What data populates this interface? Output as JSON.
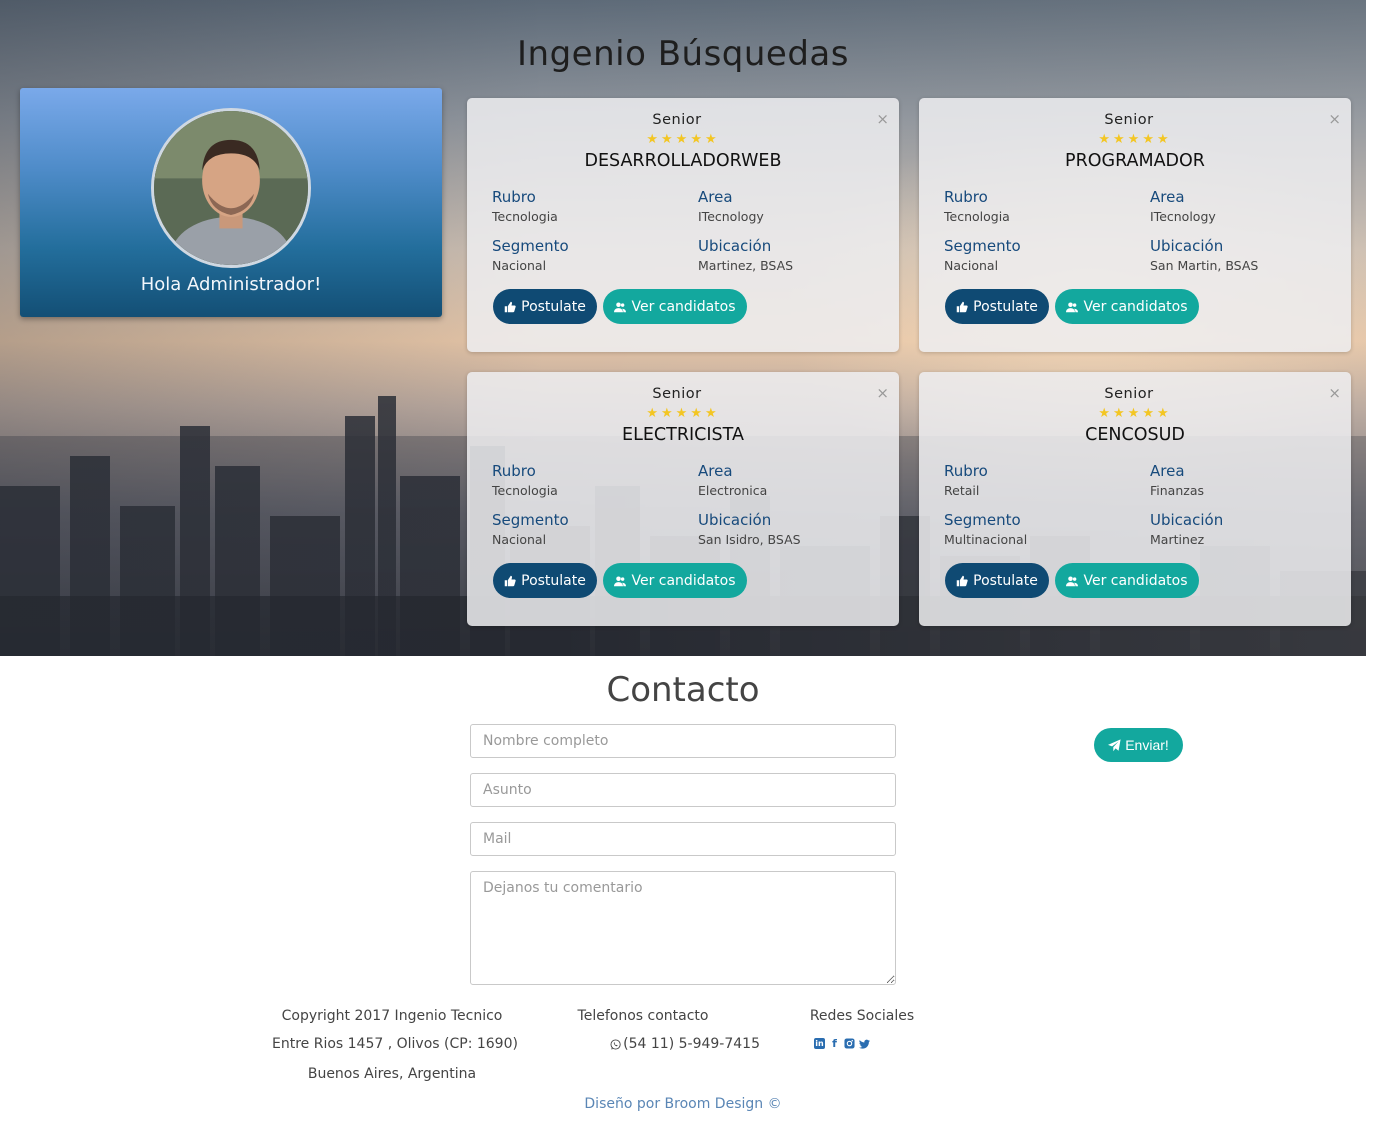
{
  "header": {
    "title": "Ingenio Búsquedas"
  },
  "profile": {
    "greeting": "Hola Administrador!"
  },
  "field_labels": {
    "rubro": "Rubro",
    "area": "Area",
    "segmento": "Segmento",
    "ubicacion": "Ubicación"
  },
  "buttons": {
    "postulate": "Postulate",
    "candidatos": "Ver candidatos",
    "close": "×"
  },
  "jobs": [
    {
      "level": "Senior",
      "stars": "★★★★★",
      "title": "DESARROLLADORWEB",
      "rubro": "Tecnologia",
      "area": "ITecnology",
      "segmento": "Nacional",
      "ubicacion": "Martinez, BSAS"
    },
    {
      "level": "Senior",
      "stars": "★★★★★",
      "title": "PROGRAMADOR",
      "rubro": "Tecnologia",
      "area": "ITecnology",
      "segmento": "Nacional",
      "ubicacion": "San Martin, BSAS"
    },
    {
      "level": "Senior",
      "stars": "★★★★★",
      "title": "ELECTRICISTA",
      "rubro": "Tecnologia",
      "area": "Electronica",
      "segmento": "Nacional",
      "ubicacion": "San Isidro, BSAS"
    },
    {
      "level": "Senior",
      "stars": "★★★★★",
      "title": "CENCOSUD",
      "rubro": "Retail",
      "area": "Finanzas",
      "segmento": "Multinacional",
      "ubicacion": "Martinez"
    }
  ],
  "contact": {
    "title": "Contacto",
    "name_placeholder": "Nombre completo",
    "subject_placeholder": "Asunto",
    "mail_placeholder": "Mail",
    "comment_placeholder": "Dejanos tu comentario",
    "send_label": "Enviar!"
  },
  "footer": {
    "copyright": "Copyright 2017 Ingenio Tecnico",
    "address1": "Entre Rios 1457 , Olivos (CP: 1690)",
    "address2": "Buenos Aires, Argentina",
    "phones_title": "Telefonos contacto",
    "phone": "(54 11) 5-949-7415",
    "social_title": "Redes Sociales",
    "social_icons": [
      "linkedin-icon",
      "facebook-icon",
      "instagram-icon",
      "twitter-icon"
    ],
    "credit": "Diseño por Broom Design ©"
  },
  "colors": {
    "primary": "#0f4a73",
    "accent": "#13a89e",
    "label": "#174a7c",
    "star": "#f3c623"
  }
}
